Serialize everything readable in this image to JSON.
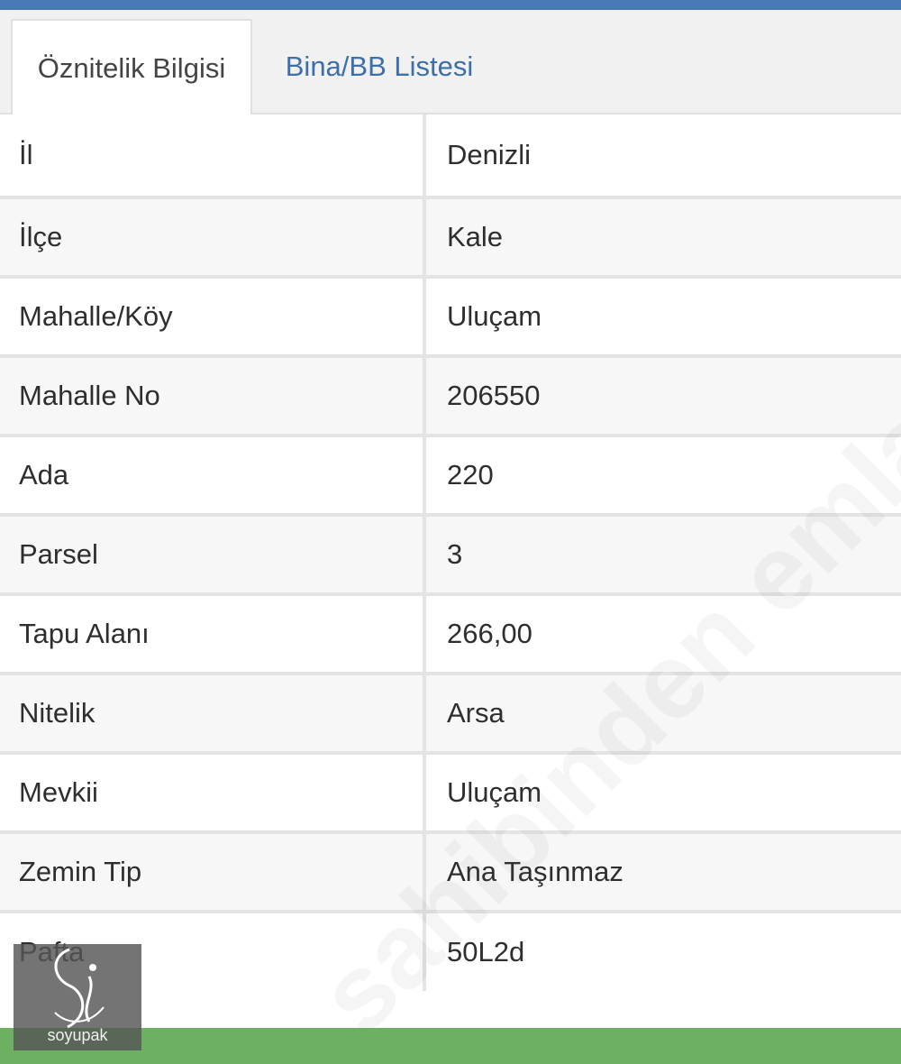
{
  "tabs": [
    {
      "label": "Öznitelik Bilgisi",
      "active": true
    },
    {
      "label": "Bina/BB Listesi",
      "active": false
    }
  ],
  "attributes": [
    {
      "key": "İl",
      "value": "Denizli"
    },
    {
      "key": "İlçe",
      "value": "Kale"
    },
    {
      "key": "Mahalle/Köy",
      "value": "Uluçam"
    },
    {
      "key": "Mahalle No",
      "value": "206550"
    },
    {
      "key": "Ada",
      "value": "220"
    },
    {
      "key": "Parsel",
      "value": "3"
    },
    {
      "key": "Tapu Alanı",
      "value": "266,00"
    },
    {
      "key": "Nitelik",
      "value": "Arsa"
    },
    {
      "key": "Mevkii",
      "value": "Uluçam"
    },
    {
      "key": "Zemin Tip",
      "value": "Ana Taşınmaz"
    },
    {
      "key": "Pafta",
      "value": "50L2d"
    }
  ],
  "watermark": "sahibinden emlakjet.com",
  "logo": {
    "text": "soyupak"
  },
  "colors": {
    "top_bar": "#4a7ab5",
    "bottom_bar": "#6db062",
    "tab_link": "#3d6fa8"
  }
}
